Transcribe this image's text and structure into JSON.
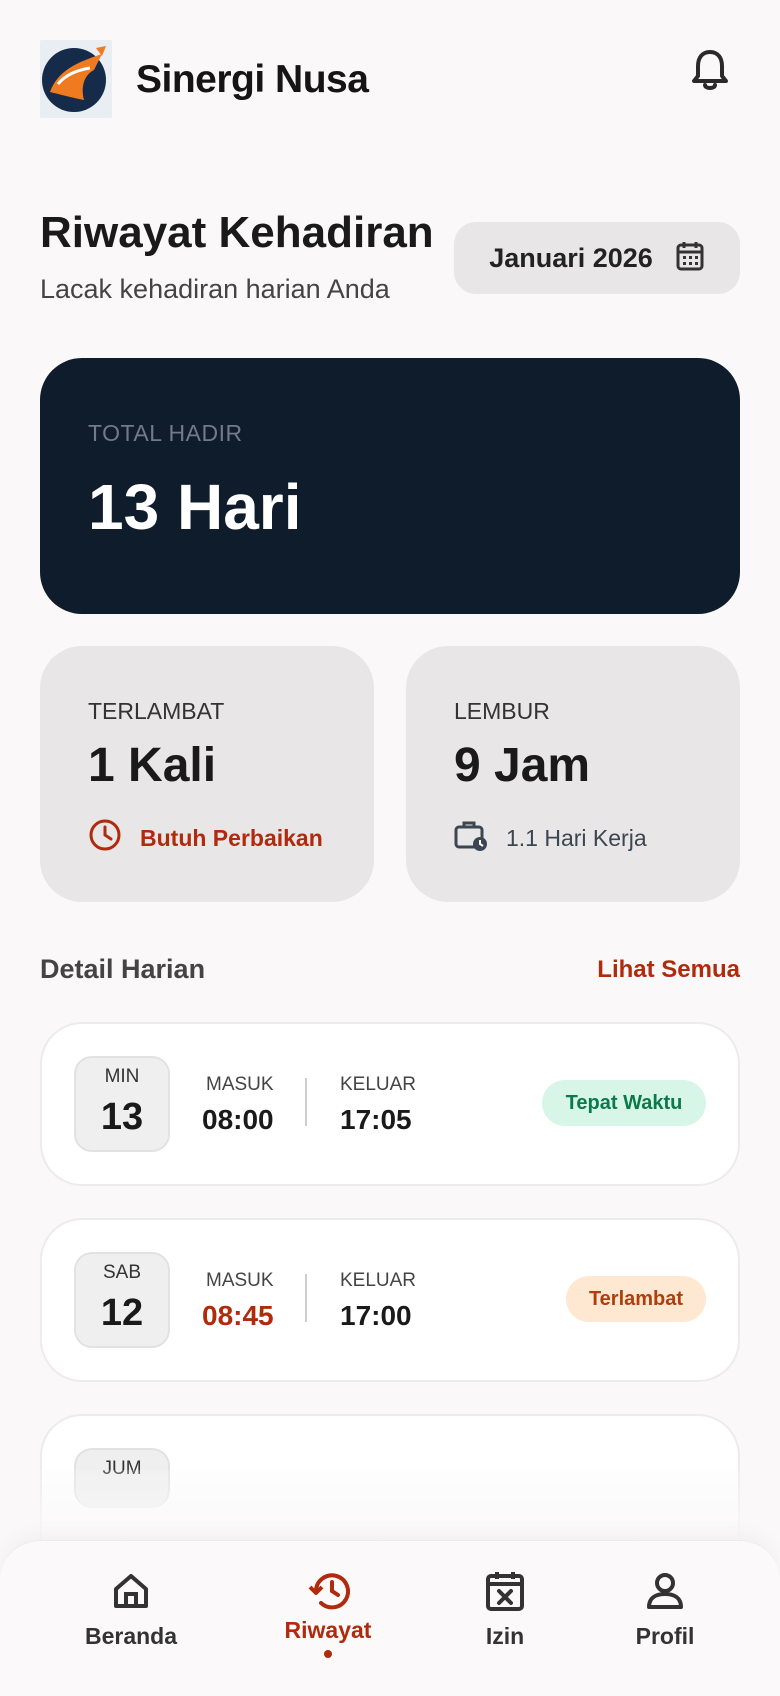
{
  "header": {
    "brand": "Sinergi Nusa",
    "logo_icon": "bird-logo-icon",
    "bell_icon": "bell-icon"
  },
  "page": {
    "title": "Riwayat Kehadiran",
    "subtitle": "Lacak kehadiran harian Anda",
    "month": "Januari 2026",
    "month_icon": "calendar-icon"
  },
  "total": {
    "label": "TOTAL HADIR",
    "value": "13 Hari"
  },
  "late_stat": {
    "label": "TERLAMBAT",
    "value": "1 Kali",
    "note": "Butuh Perbaikan",
    "icon": "clock-icon"
  },
  "overtime_stat": {
    "label": "LEMBUR",
    "value": "9 Jam",
    "note": "1.1 Hari Kerja",
    "icon": "briefcase-clock-icon"
  },
  "daily": {
    "title": "Detail Harian",
    "see_all": "Lihat Semua",
    "in_label": "MASUK",
    "out_label": "KELUAR",
    "rows": [
      {
        "dow": "MIN",
        "day": "13",
        "in": "08:00",
        "out": "17:05",
        "status": "Tepat Waktu"
      },
      {
        "dow": "SAB",
        "day": "12",
        "in": "08:45",
        "out": "17:00",
        "status": "Terlambat"
      },
      {
        "dow": "JUM",
        "day": "",
        "in": "",
        "out": "",
        "status": ""
      }
    ]
  },
  "nav": {
    "items": [
      {
        "label": "Beranda",
        "icon": "home-icon"
      },
      {
        "label": "Riwayat",
        "icon": "history-icon",
        "active": true
      },
      {
        "label": "Izin",
        "icon": "calendar-x-icon"
      },
      {
        "label": "Profil",
        "icon": "user-icon"
      }
    ]
  },
  "colors": {
    "accent": "#b02a0c",
    "dark_card": "#0f1c2c",
    "success": "#0b7a4b",
    "warning_bg": "#ffe8d2"
  }
}
